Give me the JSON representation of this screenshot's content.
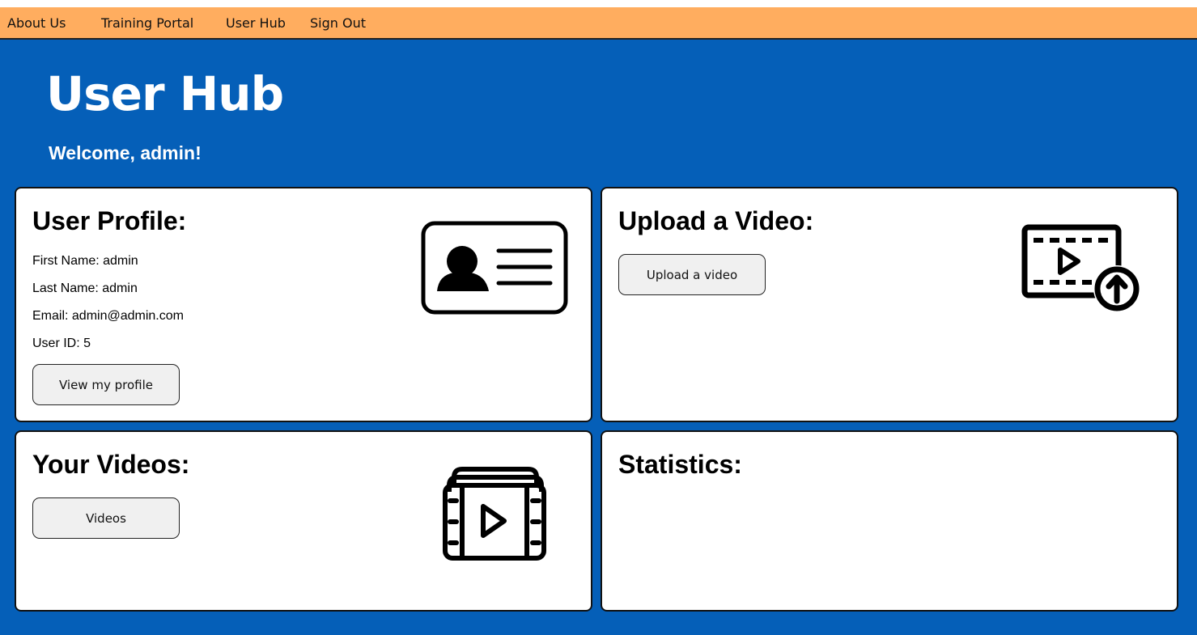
{
  "nav": {
    "items": [
      {
        "label": "About Us"
      },
      {
        "label": "Training Portal"
      },
      {
        "label": "User Hub"
      },
      {
        "label": "Sign Out"
      }
    ]
  },
  "header": {
    "title": "User Hub",
    "welcome": "Welcome, admin!"
  },
  "profile_card": {
    "title": "User Profile:",
    "first_name": "First Name: admin",
    "last_name": "Last Name: admin",
    "email": "Email: admin@admin.com",
    "user_id": "User ID: 5",
    "button_label": "View my profile",
    "icon": "id-card-icon"
  },
  "upload_card": {
    "title": "Upload a Video:",
    "button_label": "Upload a video",
    "icon": "video-upload-icon"
  },
  "videos_card": {
    "title": "Your Videos:",
    "button_label": "Videos",
    "icon": "video-library-icon"
  },
  "stats_card": {
    "title": "Statistics:"
  },
  "colors": {
    "nav_background": "#ffad5f",
    "page_background": "#055fb8",
    "card_background": "#ffffff",
    "button_background": "#f0f0f0"
  }
}
